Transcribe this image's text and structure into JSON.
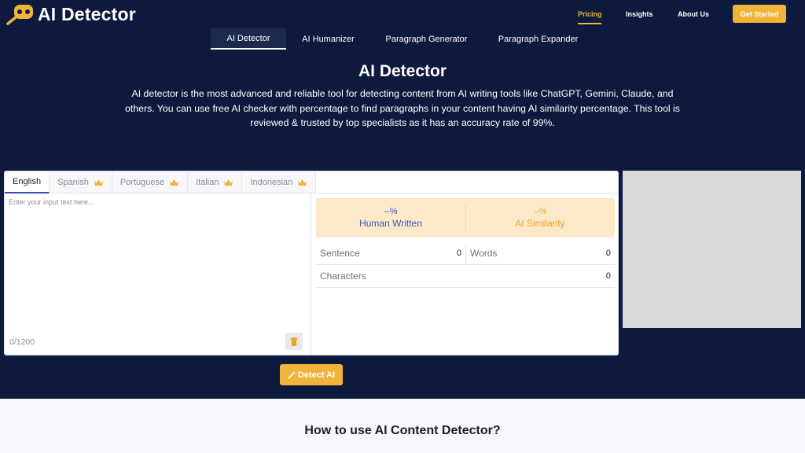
{
  "brand": {
    "name_prefix": "AI",
    "name_suffix": "Detector"
  },
  "nav": {
    "pricing": "Pricing",
    "insights": "Insights",
    "about": "About Us",
    "cta": "Get Started"
  },
  "tool_tabs": [
    "AI Detector",
    "AI Humanizer",
    "Paragraph Generator",
    "Paragraph Expander"
  ],
  "hero": {
    "title": "AI Detector",
    "description": "AI detector is the most advanced and reliable tool for detecting content from AI writing tools like ChatGPT, Gemini, Claude, and others. You can use free AI checker with percentage to find paragraphs in your content having AI similarity percentage. This tool is reviewed & trusted by top specialists as it has an accuracy rate of 99%."
  },
  "languages": [
    "English",
    "Spanish",
    "Portuguese",
    "Italian",
    "Indonesian"
  ],
  "input": {
    "placeholder": "Enter your input text here...",
    "counter": "0/1200"
  },
  "scores": {
    "human": {
      "value": "--%",
      "label": "Human Written"
    },
    "ai": {
      "value": "--%",
      "label": "AI Similarity"
    }
  },
  "stats": {
    "sentence": {
      "label": "Sentence",
      "value": "0"
    },
    "words": {
      "label": "Words",
      "value": "0"
    },
    "characters": {
      "label": "Characters",
      "value": "0"
    }
  },
  "detect_button": "Detect AI",
  "section_heading": "How to use AI Content Detector?",
  "colors": {
    "navy": "#0e1a3d",
    "accent": "#f0b43a",
    "human": "#3a55b5"
  }
}
